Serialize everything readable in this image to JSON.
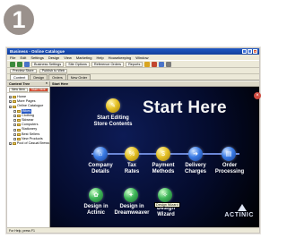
{
  "step_number": "1",
  "window": {
    "title": "Business - Online Catalogue",
    "controls": [
      "_",
      "□",
      "×"
    ]
  },
  "menu": [
    "File",
    "Edit",
    "Settings",
    "Design",
    "View",
    "Marketing",
    "Help",
    "Housekeeping",
    "Window"
  ],
  "toolbar": {
    "business_settings": "Business Settings",
    "site_options": "Site Options",
    "reference_orders": "Reference Orders",
    "reports": "Reports"
  },
  "toolbar2": {
    "preview_store": "Preview Store",
    "publish_to_web": "Publish to Web"
  },
  "tabs": [
    "Content",
    "Design",
    "Orders",
    "New Order"
  ],
  "left_pane": {
    "title": "Content Tree",
    "buttons": {
      "new_item": "New Item",
      "start_here": "Start Here"
    },
    "tree": [
      {
        "label": "Home",
        "sel": false,
        "indent": 0
      },
      {
        "label": "More Pages",
        "sel": false,
        "indent": 0
      },
      {
        "label": "Online Catalogue",
        "sel": false,
        "indent": 0
      },
      {
        "label": "Bikes",
        "sel": true,
        "indent": 1
      },
      {
        "label": "Clothing",
        "sel": false,
        "indent": 1
      },
      {
        "label": "Skiwear",
        "sel": false,
        "indent": 1
      },
      {
        "label": "Computers",
        "sel": false,
        "indent": 1
      },
      {
        "label": "Stationery",
        "sel": false,
        "indent": 1
      },
      {
        "label": "Best Sellers",
        "sel": false,
        "indent": 1
      },
      {
        "label": "New Products",
        "sel": false,
        "indent": 1
      },
      {
        "label": "Pool of Casual Brews",
        "sel": false,
        "indent": 0
      }
    ]
  },
  "right_pane": {
    "title": "Start Here"
  },
  "stage": {
    "heading": "Start Here",
    "start_editing": [
      "Start Editing",
      "Store Contents"
    ],
    "steps": [
      {
        "label": [
          "Company",
          "Details"
        ],
        "color": "blue",
        "icon": "company-icon"
      },
      {
        "label": [
          "Tax",
          "Rates"
        ],
        "color": "yellow",
        "icon": "tax-icon"
      },
      {
        "label": [
          "Payment",
          "Methods"
        ],
        "color": "yellow",
        "icon": "payment-icon"
      },
      {
        "label": [
          "Delivery",
          "Charges"
        ],
        "color": "blue",
        "icon": "delivery-icon"
      },
      {
        "label": [
          "Order",
          "Processing"
        ],
        "color": "blue",
        "icon": "order-icon"
      }
    ],
    "design_actinic": [
      "Design in",
      "Actinic"
    ],
    "design_dreamweaver": [
      "Design in",
      "Dreamweaver"
    ],
    "design_wizard": [
      "Design",
      "Wizard"
    ],
    "tooltip": "Design Wizard",
    "brand": "ACTINIC"
  },
  "status": "For Help, press F1"
}
